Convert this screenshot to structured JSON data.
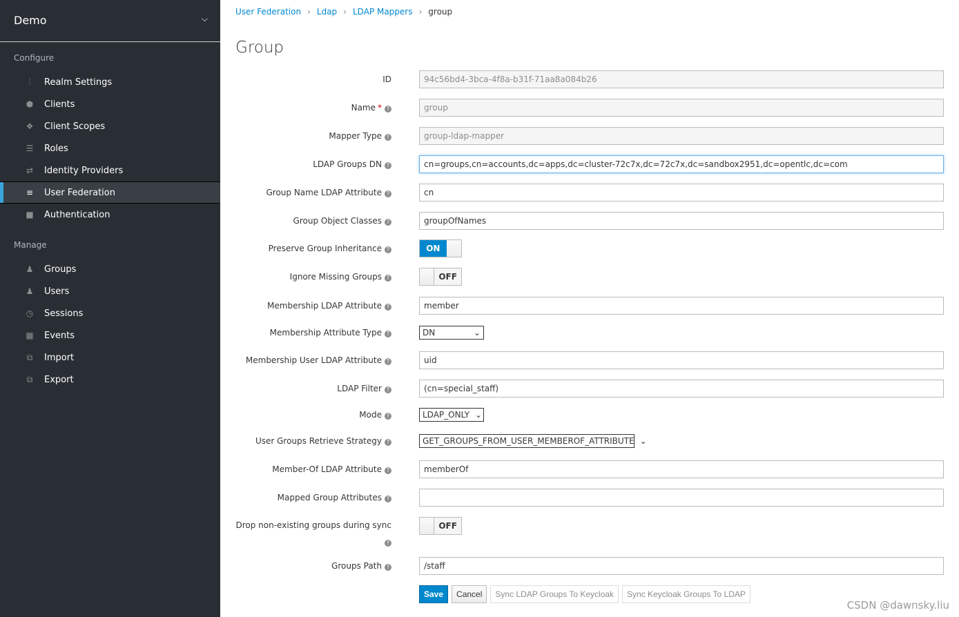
{
  "sidebar": {
    "realm": "Demo",
    "configure_label": "Configure",
    "manage_label": "Manage",
    "configure": [
      {
        "label": "Realm Settings",
        "icon": "sliders-icon"
      },
      {
        "label": "Clients",
        "icon": "cube-icon"
      },
      {
        "label": "Client Scopes",
        "icon": "cubes-icon"
      },
      {
        "label": "Roles",
        "icon": "list-icon"
      },
      {
        "label": "Identity Providers",
        "icon": "exchange-icon"
      },
      {
        "label": "User Federation",
        "icon": "database-icon",
        "active": true
      },
      {
        "label": "Authentication",
        "icon": "lock-icon"
      }
    ],
    "manage": [
      {
        "label": "Groups",
        "icon": "users-icon"
      },
      {
        "label": "Users",
        "icon": "user-icon"
      },
      {
        "label": "Sessions",
        "icon": "clock-icon"
      },
      {
        "label": "Events",
        "icon": "calendar-icon"
      },
      {
        "label": "Import",
        "icon": "import-icon"
      },
      {
        "label": "Export",
        "icon": "export-icon"
      }
    ]
  },
  "breadcrumb": [
    "User Federation",
    "Ldap",
    "LDAP Mappers",
    "group"
  ],
  "title": "Group",
  "form": {
    "id": {
      "label": "ID",
      "value": "94c56bd4-3bca-4f8a-b31f-71aa8a084b26"
    },
    "name": {
      "label": "Name",
      "value": "group"
    },
    "mapper_type": {
      "label": "Mapper Type",
      "value": "group-ldap-mapper"
    },
    "groups_dn": {
      "label": "LDAP Groups DN",
      "value": "cn=groups,cn=accounts,dc=apps,dc=cluster-72c7x,dc=72c7x,dc=sandbox2951,dc=opentlc,dc=com"
    },
    "group_name_attr": {
      "label": "Group Name LDAP Attribute",
      "value": "cn"
    },
    "object_classes": {
      "label": "Group Object Classes",
      "value": "groupOfNames"
    },
    "preserve": {
      "label": "Preserve Group Inheritance",
      "value": "ON"
    },
    "ignore_missing": {
      "label": "Ignore Missing Groups",
      "value": "OFF"
    },
    "membership_attr": {
      "label": "Membership LDAP Attribute",
      "value": "member"
    },
    "membership_type": {
      "label": "Membership Attribute Type",
      "value": "DN"
    },
    "membership_user_attr": {
      "label": "Membership User LDAP Attribute",
      "value": "uid"
    },
    "ldap_filter": {
      "label": "LDAP Filter",
      "value": "(cn=special_staff)"
    },
    "mode": {
      "label": "Mode",
      "value": "LDAP_ONLY"
    },
    "strategy": {
      "label": "User Groups Retrieve Strategy",
      "value": "GET_GROUPS_FROM_USER_MEMBEROF_ATTRIBUTE"
    },
    "member_of": {
      "label": "Member-Of LDAP Attribute",
      "value": "memberOf"
    },
    "mapped_attrs": {
      "label": "Mapped Group Attributes",
      "value": ""
    },
    "drop": {
      "label": "Drop non-existing groups during sync",
      "value": "OFF"
    },
    "groups_path": {
      "label": "Groups Path",
      "value": "/staff"
    }
  },
  "buttons": {
    "save": "Save",
    "cancel": "Cancel",
    "sync_to_kc": "Sync LDAP Groups To Keycloak",
    "sync_to_ldap": "Sync Keycloak Groups To LDAP"
  },
  "watermark": "CSDN @dawnsky.liu"
}
